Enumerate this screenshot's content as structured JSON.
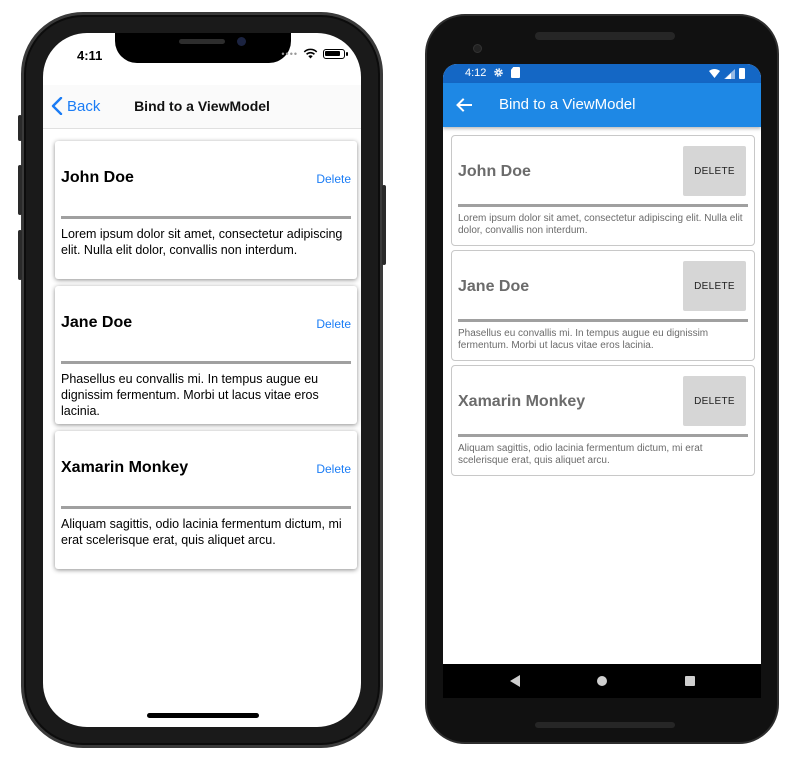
{
  "ios": {
    "status_time": "4:11",
    "nav": {
      "back_label": "Back",
      "title": "Bind to a ViewModel"
    },
    "items": [
      {
        "name": "John Doe",
        "delete_label": "Delete",
        "description": "Lorem ipsum dolor sit amet, consectetur adipiscing elit. Nulla elit dolor, convallis non interdum."
      },
      {
        "name": "Jane Doe",
        "delete_label": "Delete",
        "description": "Phasellus eu convallis mi. In tempus augue eu dignissim fermentum. Morbi ut lacus vitae eros lacinia."
      },
      {
        "name": "Xamarin Monkey",
        "delete_label": "Delete",
        "description": "Aliquam sagittis, odio lacinia fermentum dictum, mi erat scelerisque erat, quis aliquet arcu."
      }
    ]
  },
  "android": {
    "status_time": "4:12",
    "appbar": {
      "title": "Bind to a ViewModel"
    },
    "items": [
      {
        "name": "John Doe",
        "delete_label": "DELETE",
        "description": "Lorem ipsum dolor sit amet, consectetur adipiscing elit. Nulla elit dolor, convallis non interdum."
      },
      {
        "name": "Jane Doe",
        "delete_label": "DELETE",
        "description": "Phasellus eu convallis mi. In tempus augue eu dignissim fermentum. Morbi ut lacus vitae eros lacinia."
      },
      {
        "name": "Xamarin Monkey",
        "delete_label": "DELETE",
        "description": "Aliquam sagittis, odio lacinia fermentum dictum, mi erat scelerisque erat, quis aliquet arcu."
      }
    ]
  },
  "colors": {
    "ios_accent": "#1a7cf5",
    "android_appbar": "#1e88e5",
    "android_statusbar": "#1467c5",
    "divider": "#a0a0a0"
  },
  "icons": {
    "ios_back": "chevron-left-icon",
    "android_back": "arrow-left-icon",
    "android_nav": [
      "triangle-back-icon",
      "circle-home-icon",
      "square-recents-icon"
    ]
  }
}
